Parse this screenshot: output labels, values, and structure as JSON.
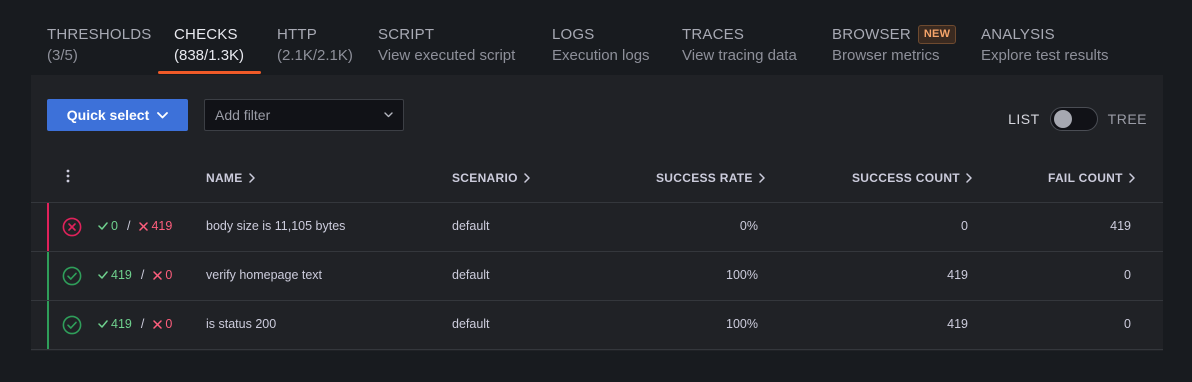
{
  "tabs": [
    {
      "title": "THRESHOLDS",
      "sub": "(3/5)"
    },
    {
      "title": "CHECKS",
      "sub": "(838/1.3K)"
    },
    {
      "title": "HTTP",
      "sub": "(2.1K/2.1K)"
    },
    {
      "title": "SCRIPT",
      "sub": "View executed script"
    },
    {
      "title": "LOGS",
      "sub": "Execution logs"
    },
    {
      "title": "TRACES",
      "sub": "View tracing data"
    },
    {
      "title": "BROWSER",
      "sub": "Browser metrics",
      "badge": "NEW"
    },
    {
      "title": "ANALYSIS",
      "sub": "Explore test results"
    }
  ],
  "toolbar": {
    "quick_select": "Quick select",
    "filter_placeholder": "Add filter",
    "view_list": "LIST",
    "view_tree": "TREE"
  },
  "table": {
    "columns": {
      "name": "NAME",
      "scenario": "SCENARIO",
      "success_rate": "SUCCESS RATE",
      "success_count": "SUCCESS COUNT",
      "fail_count": "FAIL COUNT"
    },
    "rows": [
      {
        "status": "fail",
        "ok": "0",
        "sep": "/",
        "bad": "419",
        "name": "body size is 11,105 bytes",
        "scenario": "default",
        "success_rate": "0%",
        "success_count": "0",
        "fail_count": "419"
      },
      {
        "status": "pass",
        "ok": "419",
        "sep": "/",
        "bad": "0",
        "name": "verify homepage text",
        "scenario": "default",
        "success_rate": "100%",
        "success_count": "419",
        "fail_count": "0"
      },
      {
        "status": "pass",
        "ok": "419",
        "sep": "/",
        "bad": "0",
        "name": "is status 200",
        "scenario": "default",
        "success_rate": "100%",
        "success_count": "419",
        "fail_count": "0"
      }
    ]
  },
  "colors": {
    "accent_tab": "#f05a28",
    "primary_button": "#3d71d9",
    "pass": "#2f9e5a",
    "fail": "#e0225b",
    "ok_text": "#6fd18e",
    "bad_text": "#ff5e7d"
  }
}
